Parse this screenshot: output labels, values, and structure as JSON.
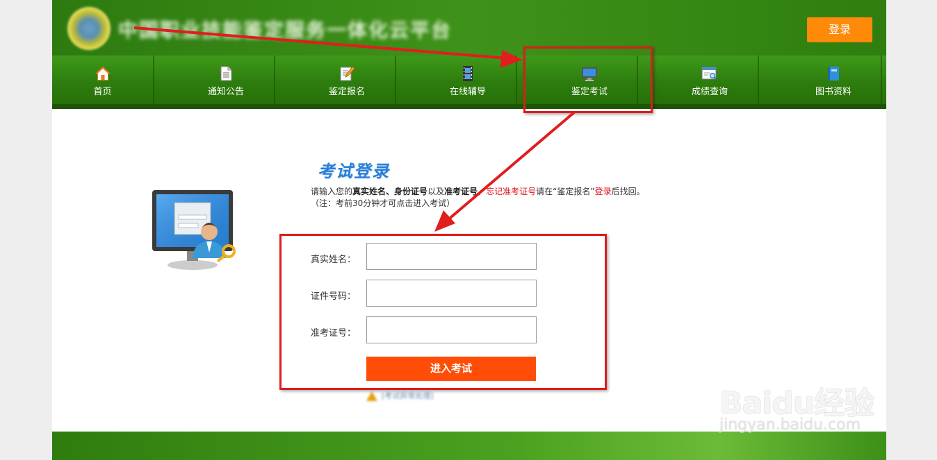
{
  "header": {
    "site_title": "中国职业技能鉴定服务一体化云平台",
    "login_label": "登录"
  },
  "nav": {
    "items": [
      {
        "label": "首页",
        "icon": "home-icon"
      },
      {
        "label": "通知公告",
        "icon": "document-icon"
      },
      {
        "label": "鉴定报名",
        "icon": "edit-document-icon"
      },
      {
        "label": "在线辅导",
        "icon": "film-icon"
      },
      {
        "label": "鉴定考试",
        "icon": "monitor-icon"
      },
      {
        "label": "成绩查询",
        "icon": "search-window-icon"
      },
      {
        "label": "图书资料",
        "icon": "book-icon"
      }
    ]
  },
  "exam": {
    "title": "考试登录",
    "desc": {
      "p1": "请输入您的",
      "b1": "真实姓名",
      "p2": "、",
      "b2": "身份证号",
      "p3": "以及",
      "b3": "准考证号",
      "p4": "，",
      "red1": "忘记准考证号",
      "p5": "请在“鉴定报名”",
      "red2": "登录",
      "p6": "后找回。",
      "note": "（注：考前30分钟才可点击进入考试）"
    },
    "fields": [
      {
        "label": "真实姓名：",
        "value": "",
        "placeholder": ""
      },
      {
        "label": "证件号码：",
        "value": "",
        "placeholder": ""
      },
      {
        "label": "准考证号：",
        "value": "",
        "placeholder": ""
      }
    ],
    "submit_label": "进入考试",
    "hint_text": "[考试异常处理]"
  },
  "watermark": {
    "brand": "Baidu经验",
    "url": "jingyan.baidu.com"
  },
  "colors": {
    "brand_green": "#3f9219",
    "accent_orange": "#ff8a0a",
    "submit_red": "#ff4d07",
    "annotation_red": "#dd1c1c",
    "title_blue": "#2a7fd6"
  }
}
